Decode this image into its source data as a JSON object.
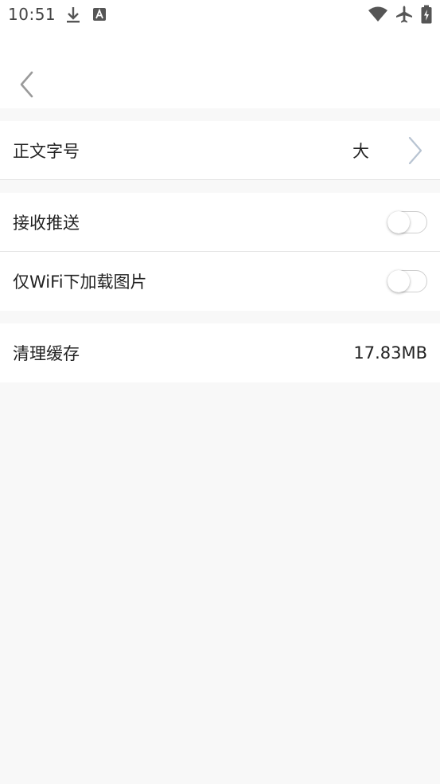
{
  "status_bar": {
    "time": "10:51",
    "icons": [
      "download-icon",
      "a-notification-icon",
      "wifi-icon",
      "airplane-mode-icon",
      "battery-charging-icon"
    ]
  },
  "nav": {
    "back_icon": "chevron-left-icon"
  },
  "settings": {
    "font_size": {
      "label": "正文字号",
      "value": "大",
      "icon": "chevron-right-icon"
    },
    "push": {
      "label": "接收推送",
      "enabled": false
    },
    "wifi_images": {
      "label": "仅WiFi下加载图片",
      "enabled": false
    },
    "cache": {
      "label": "清理缓存",
      "value": "17.83MB"
    }
  },
  "colors": {
    "background": "#f8f8f8",
    "surface": "#ffffff",
    "divider": "#e3e3e3",
    "text": "#222222",
    "icon_gray": "#9a9a9a",
    "chevron_light": "#b8c4d2"
  }
}
